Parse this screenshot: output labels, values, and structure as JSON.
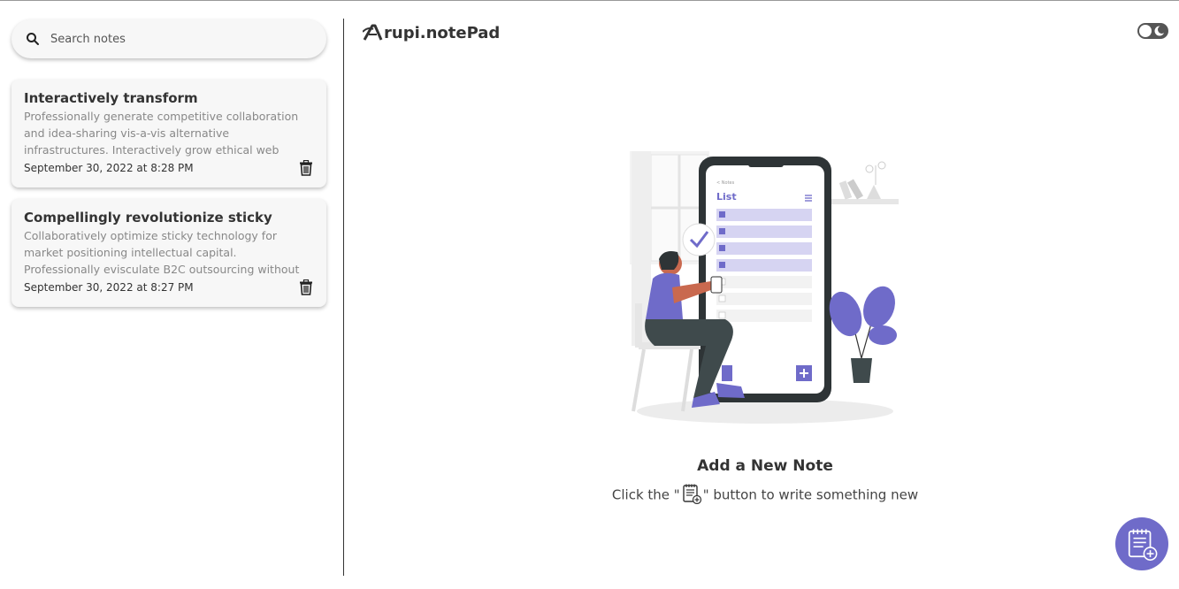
{
  "app": {
    "brand_name": "rupi.notePad",
    "accent_color": "#6f6bc9"
  },
  "search": {
    "placeholder": "Search notes",
    "icon": "search-icon"
  },
  "notes": [
    {
      "title": "Interactively transform",
      "body": "Professionally generate competitive collaboration and idea-sharing vis-a-vis alternative infrastructures. Interactively grow ethical web",
      "date": "September 30, 2022 at 8:28 PM",
      "icon": "trash-icon"
    },
    {
      "title": "Compellingly revolutionize sticky",
      "body": "Collaboratively optimize sticky technology for market positioning intellectual capital. Professionally evisculate B2C outsourcing without",
      "date": "September 30, 2022 at 8:27 PM",
      "icon": "trash-icon"
    }
  ],
  "header": {
    "theme_toggle_icon": "moon-icon"
  },
  "empty_state": {
    "title": "Add a New Note",
    "desc_before": "Click the \"",
    "desc_after": "\" button to write something new",
    "illustration": {
      "screen_title": "List",
      "screen_back": "< Notes"
    }
  },
  "fab": {
    "icon": "add-note-icon"
  }
}
